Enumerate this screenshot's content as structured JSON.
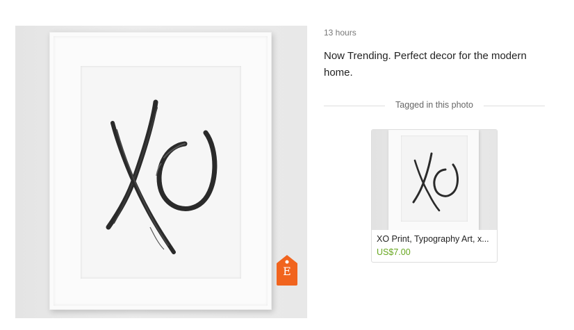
{
  "post": {
    "timestamp": "13 hours",
    "caption": "Now Trending. Perfect decor for the modern home."
  },
  "photo": {
    "artwork_text": "XO",
    "tag_icon": "etsy-tag-icon",
    "tag_letter": "E",
    "tag_color": "#f1641e"
  },
  "tagged": {
    "label": "Tagged in this photo"
  },
  "product": {
    "title": "XO Print, Typography Art, x...",
    "price": "US$7.00",
    "price_color": "#66a61e"
  }
}
